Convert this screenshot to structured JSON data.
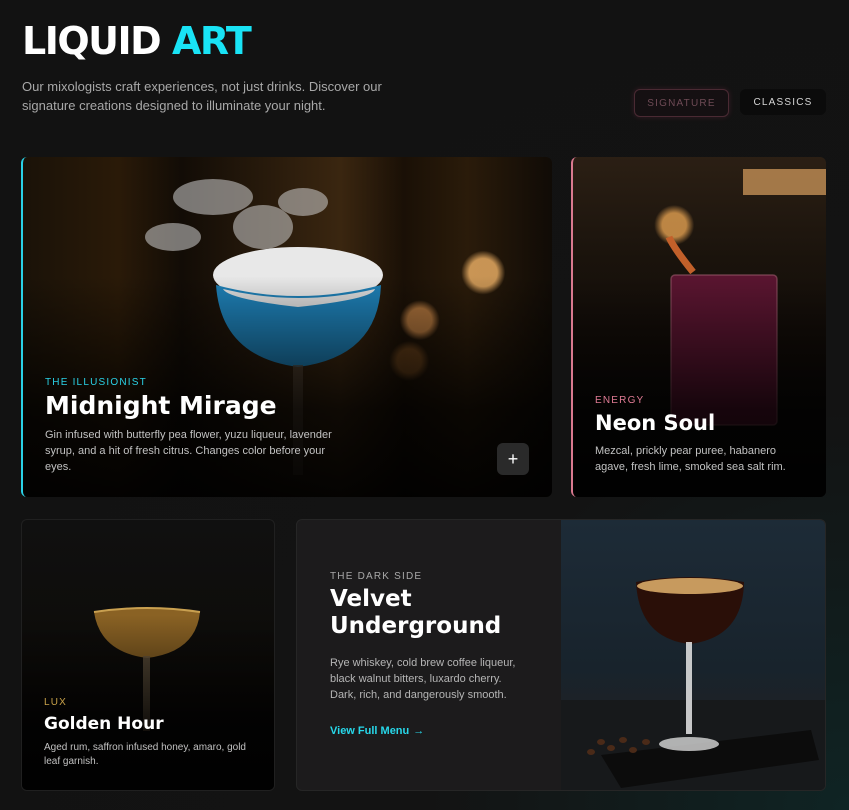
{
  "header": {
    "logo_word1": "LIQUID",
    "logo_word2": "ART",
    "intro": "Our mixologists craft experiences, not just drinks. Discover our signature creations designed to illuminate your night."
  },
  "tabs": [
    {
      "label": "SIGNATURE",
      "active": true
    },
    {
      "label": "CLASSICS",
      "active": false
    }
  ],
  "cards": {
    "midnight": {
      "eyebrow": "THE ILLUSIONIST",
      "title": "Midnight Mirage",
      "desc": "Gin infused with butterfly pea flower, yuzu liqueur, lavender syrup, and a hit of fresh citrus. Changes color before your eyes.",
      "action": "+"
    },
    "neon": {
      "eyebrow": "ENERGY",
      "title": "Neon Soul",
      "desc": "Mezcal, prickly pear puree, habanero agave, fresh lime, smoked sea salt rim."
    },
    "golden": {
      "eyebrow": "LUX",
      "title": "Golden Hour",
      "desc": "Aged rum, saffron infused honey, amaro, gold leaf garnish."
    },
    "velvet": {
      "eyebrow": "THE DARK SIDE",
      "title_line1": "Velvet",
      "title_line2": "Underground",
      "desc": "Rye whiskey, cold brew coffee liqueur, black walnut bitters, luxardo cherry. Dark, rich, and dangerously smooth.",
      "link": "View Full Menu",
      "link_arrow": "→"
    }
  },
  "colors": {
    "accent_cyan": "#19e3f5",
    "accent_pink": "#d9798f",
    "accent_gold": "#c9a24a",
    "background": "#121212"
  }
}
